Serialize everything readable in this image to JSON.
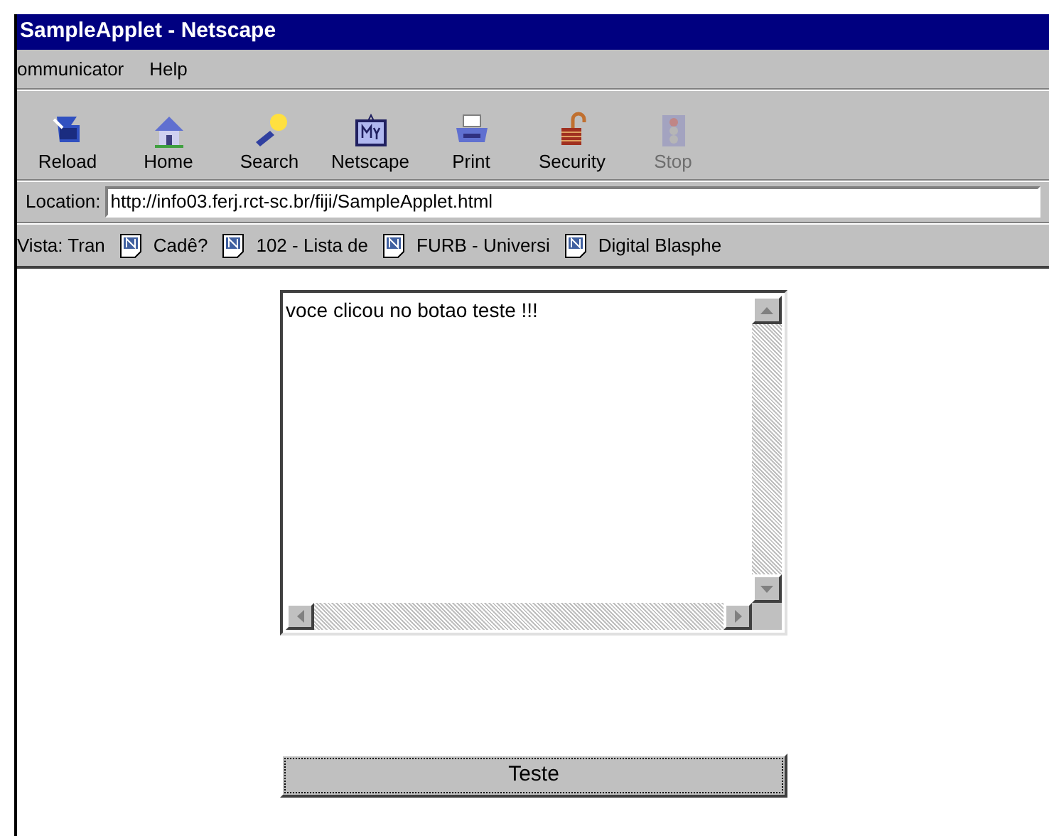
{
  "window": {
    "title": "SampleApplet - Netscape"
  },
  "menu": [
    {
      "label": "ommunicator"
    },
    {
      "label": "Help"
    }
  ],
  "toolbar": [
    {
      "label": "Reload",
      "kind": "reload",
      "disabled": false
    },
    {
      "label": "Home",
      "kind": "home",
      "disabled": false
    },
    {
      "label": "Search",
      "kind": "search",
      "disabled": false
    },
    {
      "label": "Netscape",
      "kind": "netscape",
      "disabled": false
    },
    {
      "label": "Print",
      "kind": "print",
      "disabled": false
    },
    {
      "label": "Security",
      "kind": "security",
      "disabled": false
    },
    {
      "label": "Stop",
      "kind": "stop",
      "disabled": true
    }
  ],
  "location": {
    "label": "Location:",
    "value": "http://info03.ferj.rct-sc.br/fiji/SampleApplet.html"
  },
  "bookmarks": [
    {
      "label": "Vista: Tran",
      "icon": false
    },
    {
      "label": "Cadê?",
      "icon": true
    },
    {
      "label": "102 - Lista de",
      "icon": true
    },
    {
      "label": "FURB - Universi",
      "icon": true
    },
    {
      "label": "Digital Blasphe",
      "icon": true
    }
  ],
  "applet": {
    "text_area": {
      "value": "voce clicou no botao teste !!!"
    },
    "button": {
      "label": "Teste",
      "focused": true
    }
  }
}
